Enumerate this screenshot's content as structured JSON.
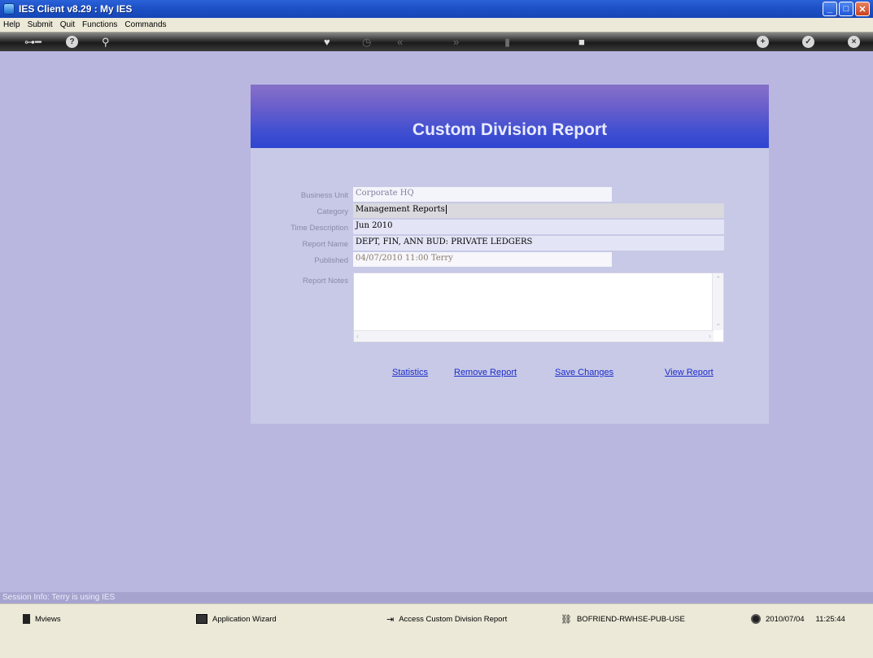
{
  "window": {
    "title": "IES Client v8.29 : My IES"
  },
  "menu": [
    "Help",
    "Submit",
    "Quit",
    "Functions",
    "Commands"
  ],
  "panel": {
    "title": "Custom Division Report",
    "fields": [
      {
        "label": "Business Unit",
        "value": "Corporate HQ"
      },
      {
        "label": "Category",
        "value": "Management Reports"
      },
      {
        "label": "Time Description",
        "value": "Jun 2010"
      },
      {
        "label": "Report Name",
        "value": "DEPT, FIN, ANN BUD: PRIVATE LEDGERS"
      },
      {
        "label": "Published",
        "value": "04/07/2010 11:00 Terry"
      },
      {
        "label": "Report Notes",
        "value": ""
      }
    ],
    "links": [
      "Statistics",
      "Remove Report",
      "Save Changes",
      "View Report"
    ]
  },
  "session": "Session Info: Terry is using IES",
  "status": {
    "mviews": "Mviews",
    "wizard": "Application Wizard",
    "access": "Access Custom Division Report",
    "server": "BOFRIEND-RWHSE-PUB-USE",
    "date": "2010/07/04",
    "time": "11:25:44"
  },
  "colors": {
    "background": "#b9b7e0",
    "header_blue": "#2f45d0",
    "link": "#1c2ccb"
  }
}
